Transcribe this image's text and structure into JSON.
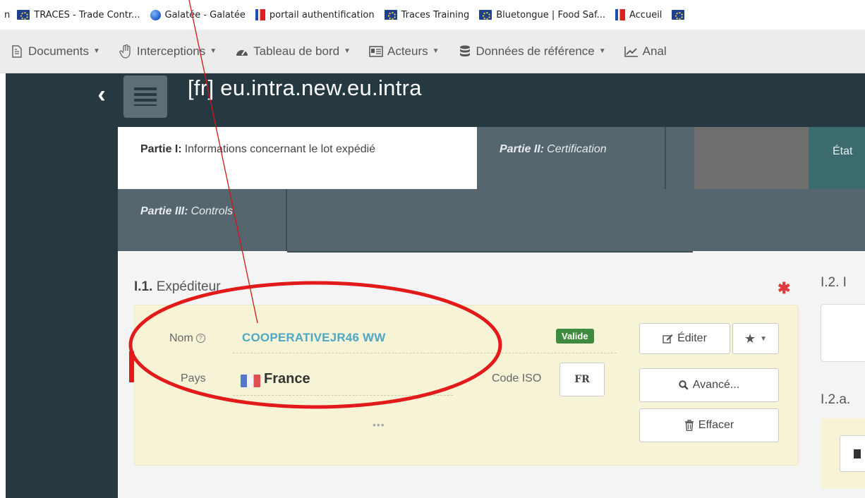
{
  "bookmarks": {
    "prefix": "n",
    "items": [
      {
        "label": "TRACES - Trade Contr...",
        "icon": "eu-flag-icon"
      },
      {
        "label": "Galatée - Galatée",
        "icon": "globe-icon"
      },
      {
        "label": "portail authentification",
        "icon": "french-site-icon"
      },
      {
        "label": "Traces Training",
        "icon": "eu-flag-icon"
      },
      {
        "label": "Bluetongue | Food Saf...",
        "icon": "eu-flag-icon"
      },
      {
        "label": "Accueil",
        "icon": "french-site-icon"
      }
    ]
  },
  "nav": {
    "items": [
      {
        "label": "Documents",
        "icon": "document-icon"
      },
      {
        "label": "Interceptions",
        "icon": "hand-icon"
      },
      {
        "label": "Tableau de bord",
        "icon": "dashboard-icon"
      },
      {
        "label": "Acteurs",
        "icon": "id-card-icon"
      },
      {
        "label": "Données de référence",
        "icon": "database-icon"
      },
      {
        "label": "Anal",
        "icon": "chart-line-icon"
      }
    ]
  },
  "header": {
    "title": "[fr] eu.intra.new.eu.intra"
  },
  "tabs": {
    "part1": {
      "prefix": "Partie I:",
      "label": "Informations concernant le lot expédié"
    },
    "part2": {
      "prefix": "Partie II:",
      "label": "Certification"
    },
    "etat": "État",
    "part3": {
      "prefix": "Partie III:",
      "label": "Controls"
    }
  },
  "section_i1": {
    "number": "I.1.",
    "title": "Expéditeur",
    "required_mark": "✱",
    "nom_label": "Nom",
    "nom_value": "COOPERATIVEJR46 WW",
    "status_badge": "Valide",
    "pays_label": "Pays",
    "pays_value": "France",
    "iso_label": "Code ISO",
    "iso_value": "FR",
    "more": "•••",
    "buttons": {
      "edit": "Éditer",
      "advanced": "Avancé...",
      "clear": "Effacer"
    }
  },
  "right_column": {
    "title_i2": "I.2. I",
    "title_i2a": "I.2.a."
  },
  "colors": {
    "header_bg": "#263840",
    "tab_bar_bg": "#56666e",
    "panel_bg": "#f6f3d6",
    "name_link": "#4fa7c6",
    "valid_badge": "#3f8a3f",
    "required_star": "#e0393e",
    "annotation_red": "#e21a1a"
  }
}
